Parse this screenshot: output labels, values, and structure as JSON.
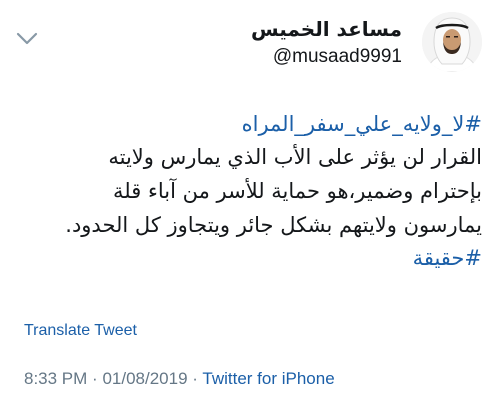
{
  "author": {
    "display_name": "مساعد الخميس",
    "handle": "@musaad9991"
  },
  "tweet": {
    "hashtag_top": "#لا_ولايه_علي_سفر_المراه",
    "lines": [
      "القرار لن يؤثر على الأب الذي يمارس ولايته",
      "بإحترام وضمير،هو حماية للأسر من آباء قلة",
      "يمارسون ولايتهم بشكل جائر ويتجاوز كل الحدود."
    ],
    "hashtag_bottom": "#حقيقة"
  },
  "actions": {
    "translate_label": "Translate Tweet"
  },
  "meta": {
    "time": "8:33 PM",
    "date": "01/08/2019",
    "separator": "·",
    "source": "Twitter for iPhone"
  },
  "colors": {
    "link": "#1b5fa8",
    "muted": "#657786",
    "text": "#14171a"
  },
  "icons": {
    "avatar": "profile-photo",
    "menu": "chevron-down-icon"
  }
}
